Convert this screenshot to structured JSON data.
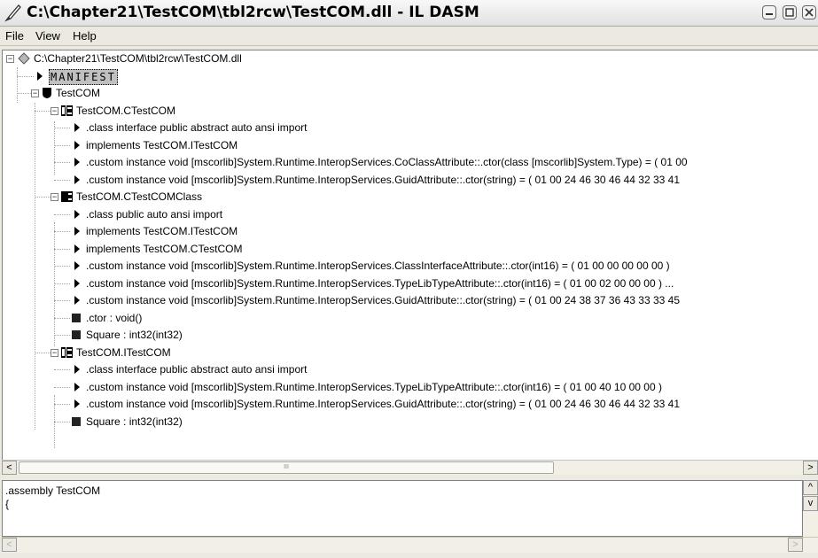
{
  "window": {
    "title": "C:\\Chapter21\\TestCOM\\tbl2rcw\\TestCOM.dll - IL DASM"
  },
  "menu": {
    "items": [
      "File",
      "View",
      "Help"
    ]
  },
  "tree": {
    "root": "C:\\Chapter21\\TestCOM\\tbl2rcw\\TestCOM.dll",
    "manifest": "MANIFEST",
    "namespace": "TestCOM",
    "types": [
      {
        "name": "TestCOM.CTestCOM",
        "kind": "interface",
        "members": [
          {
            "icon": "triangle",
            "text": ".class interface public abstract auto ansi import"
          },
          {
            "icon": "triangle",
            "text": "implements TestCOM.ITestCOM"
          },
          {
            "icon": "triangle",
            "text": ".custom instance void [mscorlib]System.Runtime.InteropServices.CoClassAttribute::.ctor(class [mscorlib]System.Type) = ( 01 00"
          },
          {
            "icon": "triangle",
            "text": ".custom instance void [mscorlib]System.Runtime.InteropServices.GuidAttribute::.ctor(string) = ( 01 00 24 46 30 46 44 32 33 41"
          }
        ]
      },
      {
        "name": "TestCOM.CTestCOMClass",
        "kind": "class",
        "members": [
          {
            "icon": "triangle",
            "text": ".class public auto ansi import"
          },
          {
            "icon": "triangle",
            "text": "implements TestCOM.ITestCOM"
          },
          {
            "icon": "triangle",
            "text": "implements TestCOM.CTestCOM"
          },
          {
            "icon": "triangle",
            "text": ".custom instance void [mscorlib]System.Runtime.InteropServices.ClassInterfaceAttribute::.ctor(int16) = ( 01 00 00 00 00 00 )"
          },
          {
            "icon": "triangle",
            "text": ".custom instance void [mscorlib]System.Runtime.InteropServices.TypeLibTypeAttribute::.ctor(int16) = ( 01 00 02 00 00 00 ) ..."
          },
          {
            "icon": "triangle",
            "text": ".custom instance void [mscorlib]System.Runtime.InteropServices.GuidAttribute::.ctor(string) = ( 01 00 24 38 37 36 43 33 33 45"
          },
          {
            "icon": "method",
            "text": ".ctor : void()"
          },
          {
            "icon": "method",
            "text": "Square : int32(int32)"
          }
        ]
      },
      {
        "name": "TestCOM.ITestCOM",
        "kind": "interface",
        "members": [
          {
            "icon": "triangle",
            "text": ".class interface public abstract auto ansi import"
          },
          {
            "icon": "triangle",
            "text": ".custom instance void [mscorlib]System.Runtime.InteropServices.TypeLibTypeAttribute::.ctor(int16) = ( 01 00 40 10 00 00 )"
          },
          {
            "icon": "triangle",
            "text": ".custom instance void [mscorlib]System.Runtime.InteropServices.GuidAttribute::.ctor(string) = ( 01 00 24 46 30 46 44 32 33 41"
          },
          {
            "icon": "method",
            "text": "Square : int32(int32)"
          }
        ]
      }
    ]
  },
  "bottom_panel": {
    "text": ".assembly TestCOM\n{"
  },
  "scrollbars": {
    "left_arrow": "<",
    "right_arrow": ">",
    "up_arrow": "^",
    "down_arrow": "v",
    "thumb_grip": "III"
  }
}
